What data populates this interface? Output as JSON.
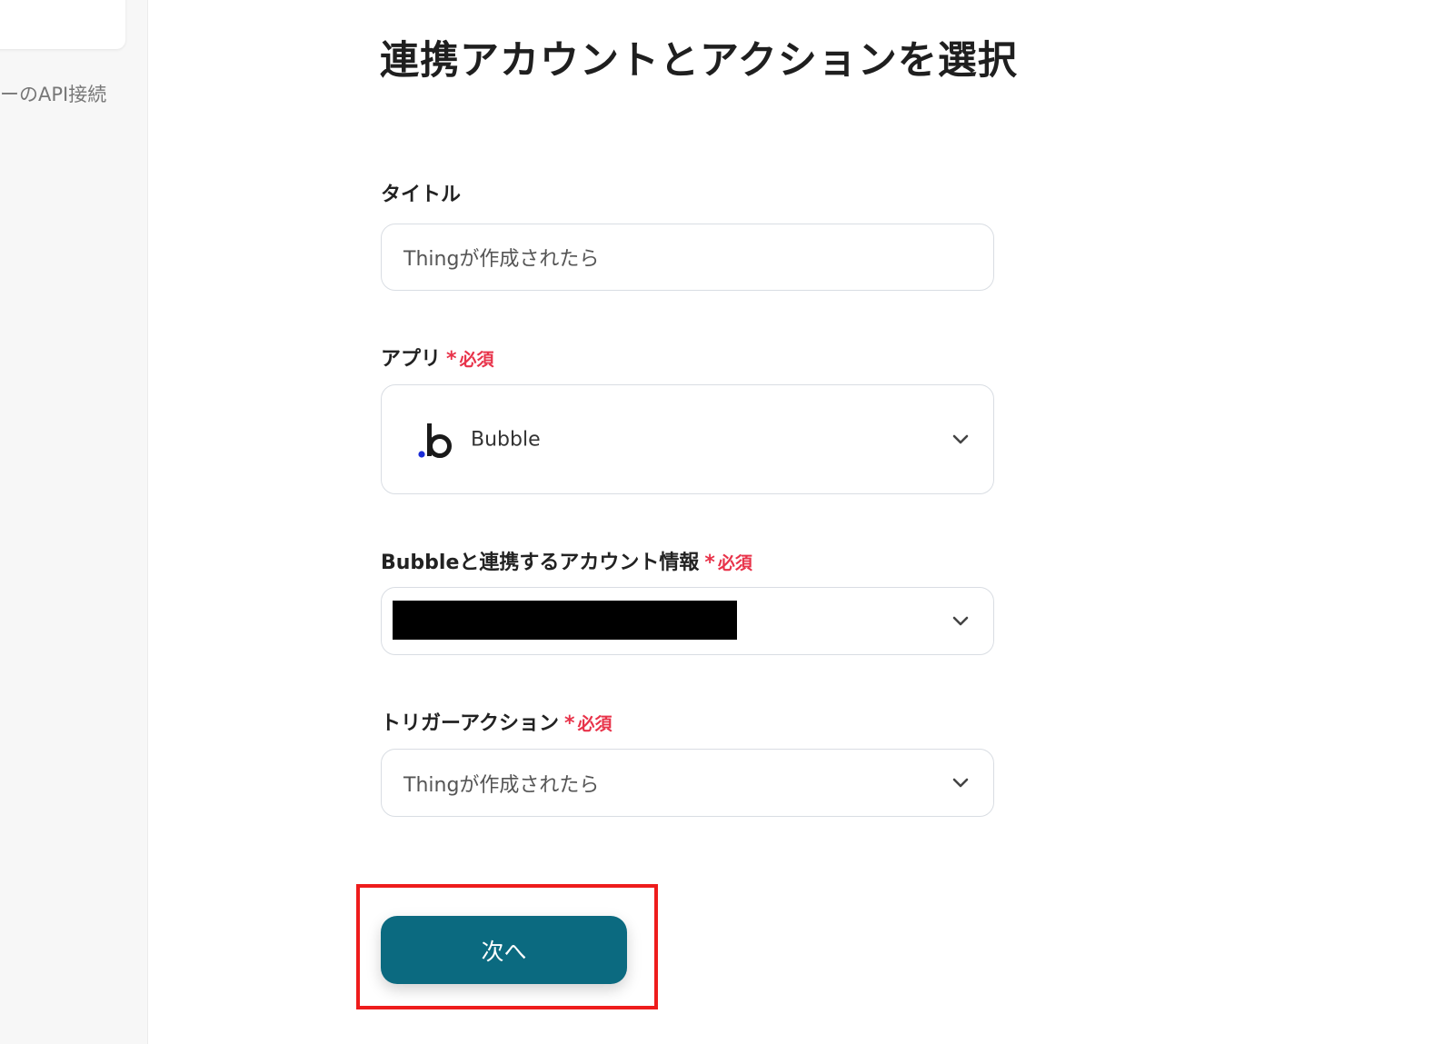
{
  "sidebar": {
    "link_label": "ーのAPI接続"
  },
  "form": {
    "page_title": "連携アカウントとアクションを選択",
    "required_label": "必須",
    "title_field": {
      "label": "タイトル",
      "value": "Thingが作成されたら"
    },
    "app_field": {
      "label": "アプリ",
      "value": "Bubble",
      "icon": "bubble-logo-icon"
    },
    "account_field": {
      "label": "Bubbleと連携するアカウント情報",
      "value_redacted": true
    },
    "trigger_field": {
      "label": "トリガーアクション",
      "value": "Thingが作成されたら"
    },
    "next_button_label": "次へ"
  },
  "colors": {
    "primary_button": "#0b6a80",
    "required": "#e8334a",
    "highlight": "#ee1c1c",
    "bubble_dot": "#1a2bd6"
  }
}
